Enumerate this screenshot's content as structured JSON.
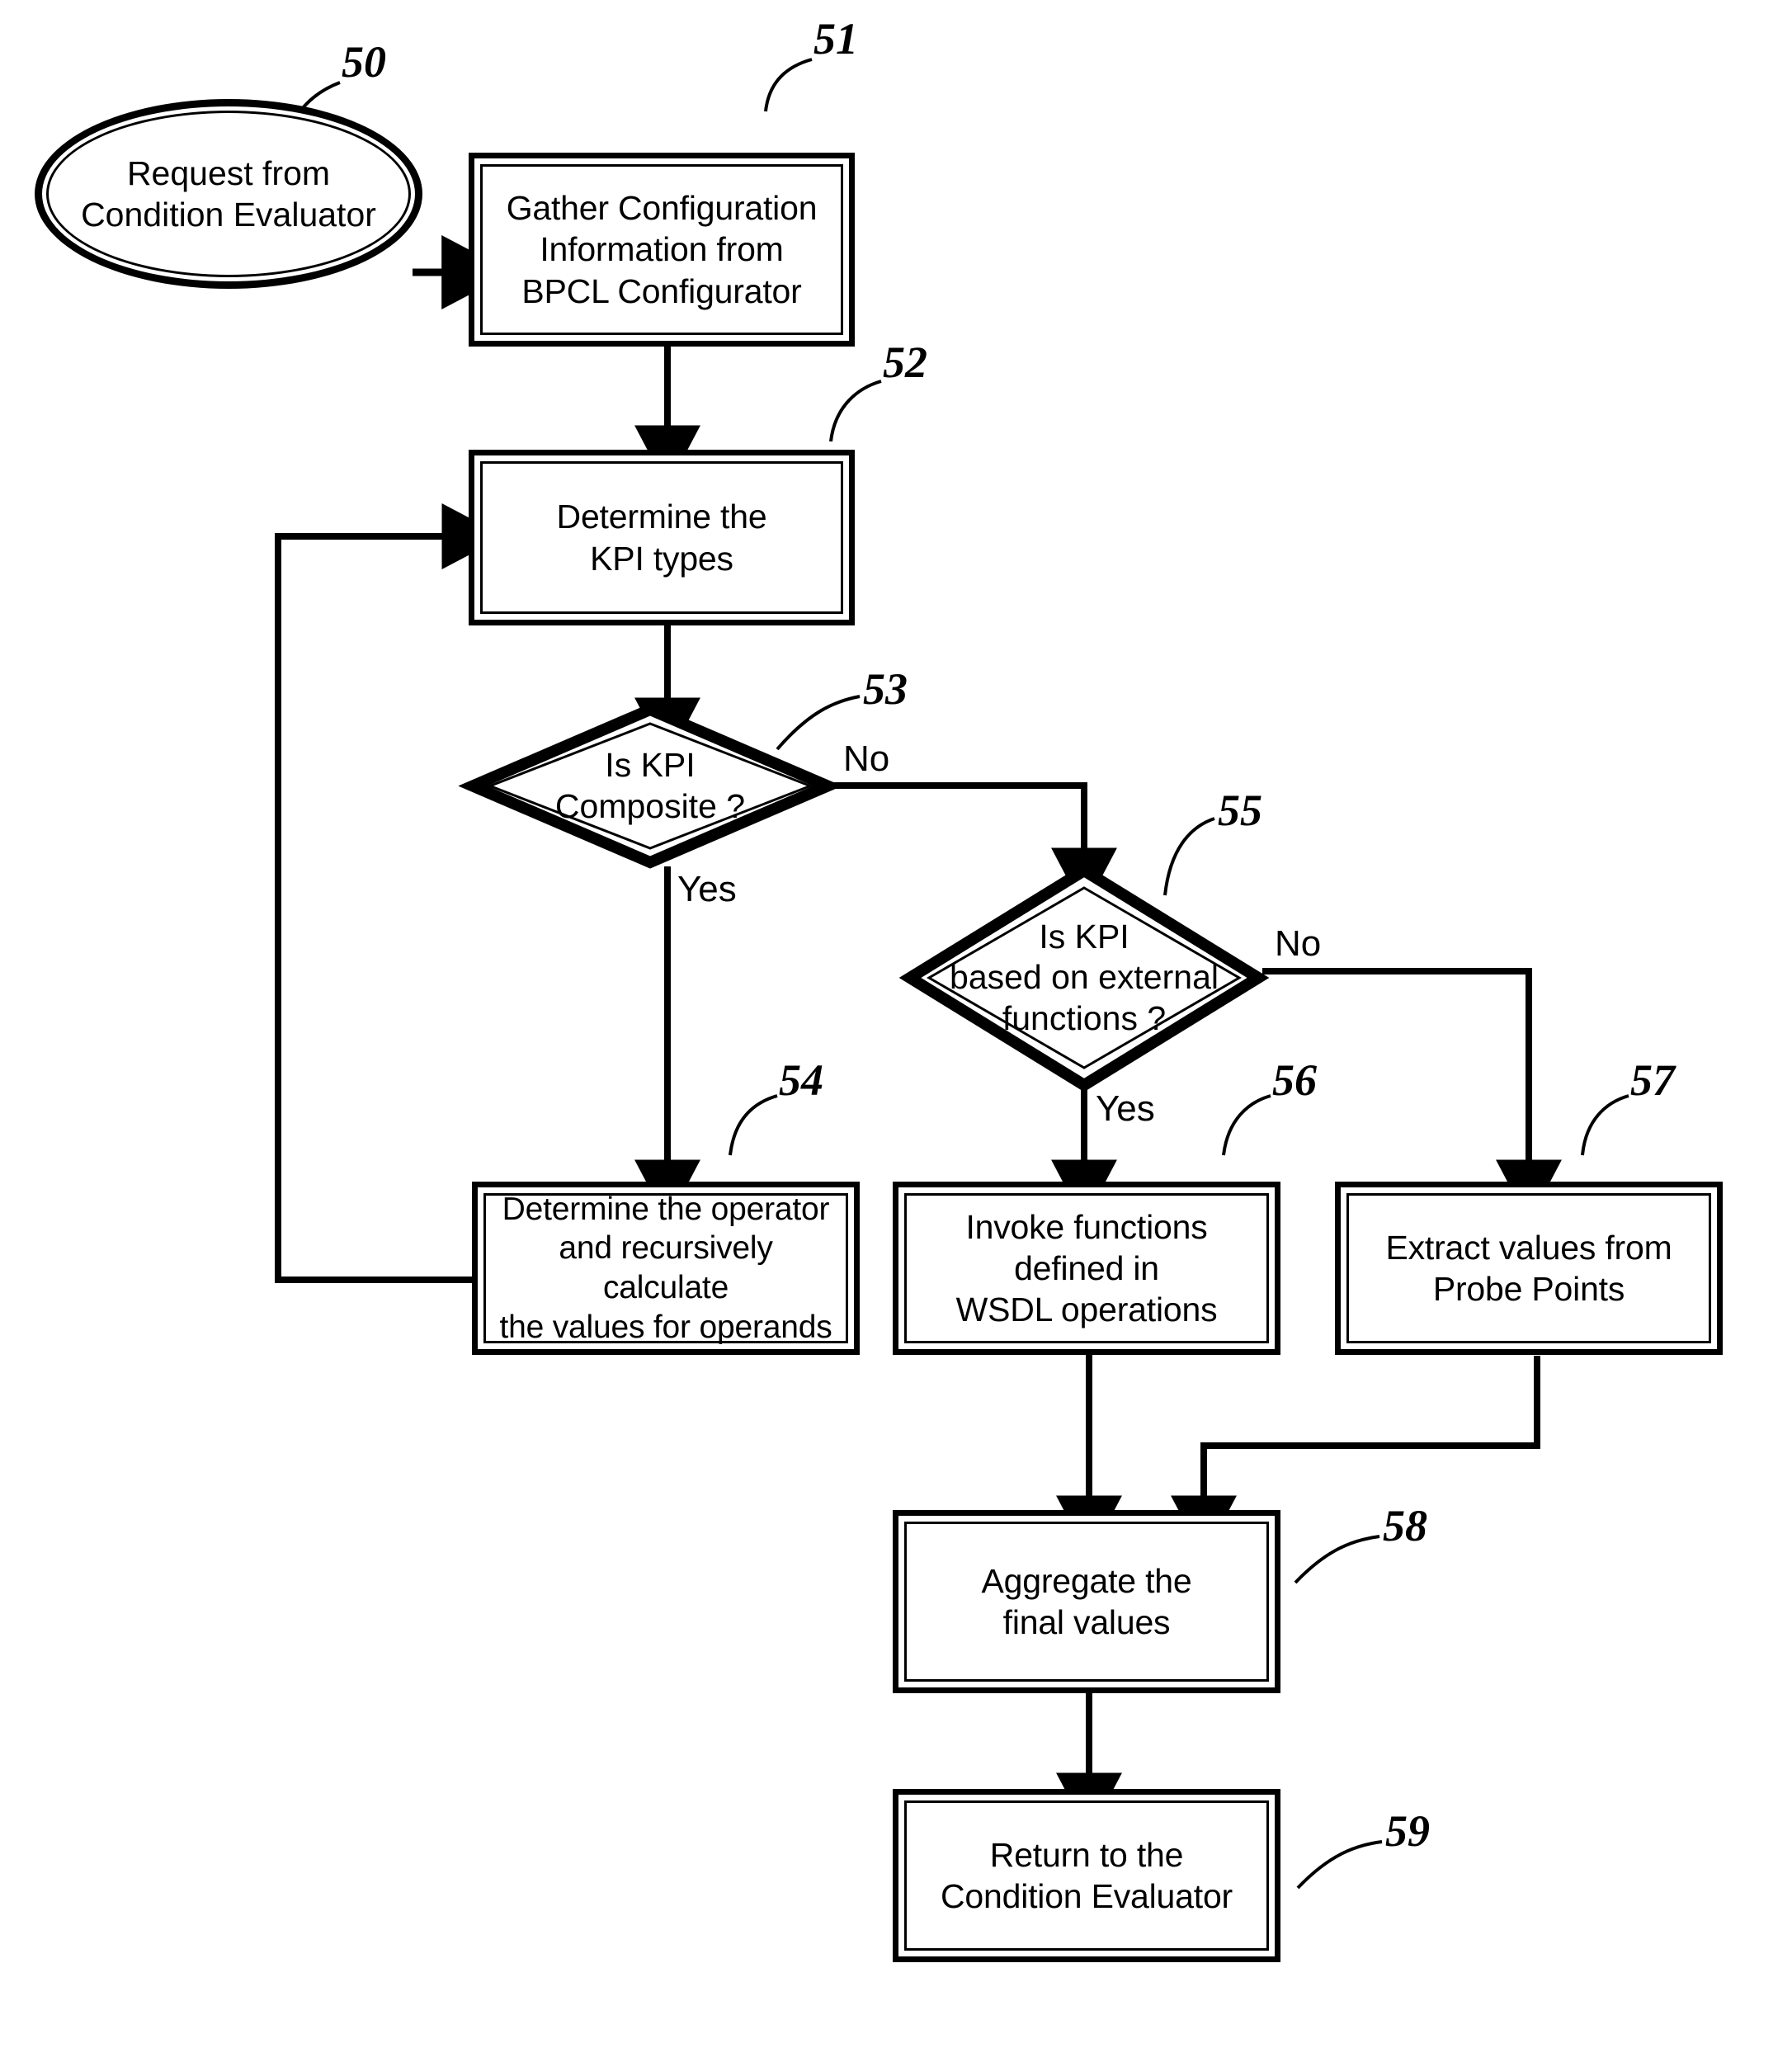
{
  "figure": {
    "title": "KPI Evaluation Flowchart",
    "ink_color": "#000000",
    "paper_color": "#ffffff"
  },
  "nodes": [
    {
      "id": "n50",
      "ref": "50",
      "shape": "terminator",
      "text": "Request from\nCondition Evaluator"
    },
    {
      "id": "n51",
      "ref": "51",
      "shape": "process",
      "text": "Gather Configuration\nInformation from\nBPCL Configurator"
    },
    {
      "id": "n52",
      "ref": "52",
      "shape": "process",
      "text": "Determine the\nKPI types"
    },
    {
      "id": "n53",
      "ref": "53",
      "shape": "decision",
      "text": "Is KPI\nComposite ?"
    },
    {
      "id": "n54",
      "ref": "54",
      "shape": "process",
      "text": "Determine the operator\nand recursively calculate\nthe values for operands"
    },
    {
      "id": "n55",
      "ref": "55",
      "shape": "decision",
      "text": "Is KPI\nbased on external\nfunctions ?"
    },
    {
      "id": "n56",
      "ref": "56",
      "shape": "process",
      "text": "Invoke functions\ndefined in\nWSDL operations"
    },
    {
      "id": "n57",
      "ref": "57",
      "shape": "process",
      "text": "Extract values from\nProbe Points"
    },
    {
      "id": "n58",
      "ref": "58",
      "shape": "process",
      "text": "Aggregate the\nfinal values"
    },
    {
      "id": "n59",
      "ref": "59",
      "shape": "process",
      "text": "Return to the\nCondition Evaluator"
    }
  ],
  "branch_labels": {
    "d53_yes": "Yes",
    "d53_no": "No",
    "d55_yes": "Yes",
    "d55_no": "No"
  },
  "edges": [
    {
      "from": "n50",
      "to": "n51",
      "label": ""
    },
    {
      "from": "n51",
      "to": "n52",
      "label": ""
    },
    {
      "from": "n52",
      "to": "n53",
      "label": ""
    },
    {
      "from": "n53",
      "to": "n54",
      "label": "Yes"
    },
    {
      "from": "n53",
      "to": "n55",
      "label": "No"
    },
    {
      "from": "n54",
      "to": "n52",
      "label": ""
    },
    {
      "from": "n55",
      "to": "n56",
      "label": "Yes"
    },
    {
      "from": "n55",
      "to": "n57",
      "label": "No"
    },
    {
      "from": "n56",
      "to": "n58",
      "label": ""
    },
    {
      "from": "n57",
      "to": "n58",
      "label": ""
    },
    {
      "from": "n58",
      "to": "n59",
      "label": ""
    }
  ]
}
